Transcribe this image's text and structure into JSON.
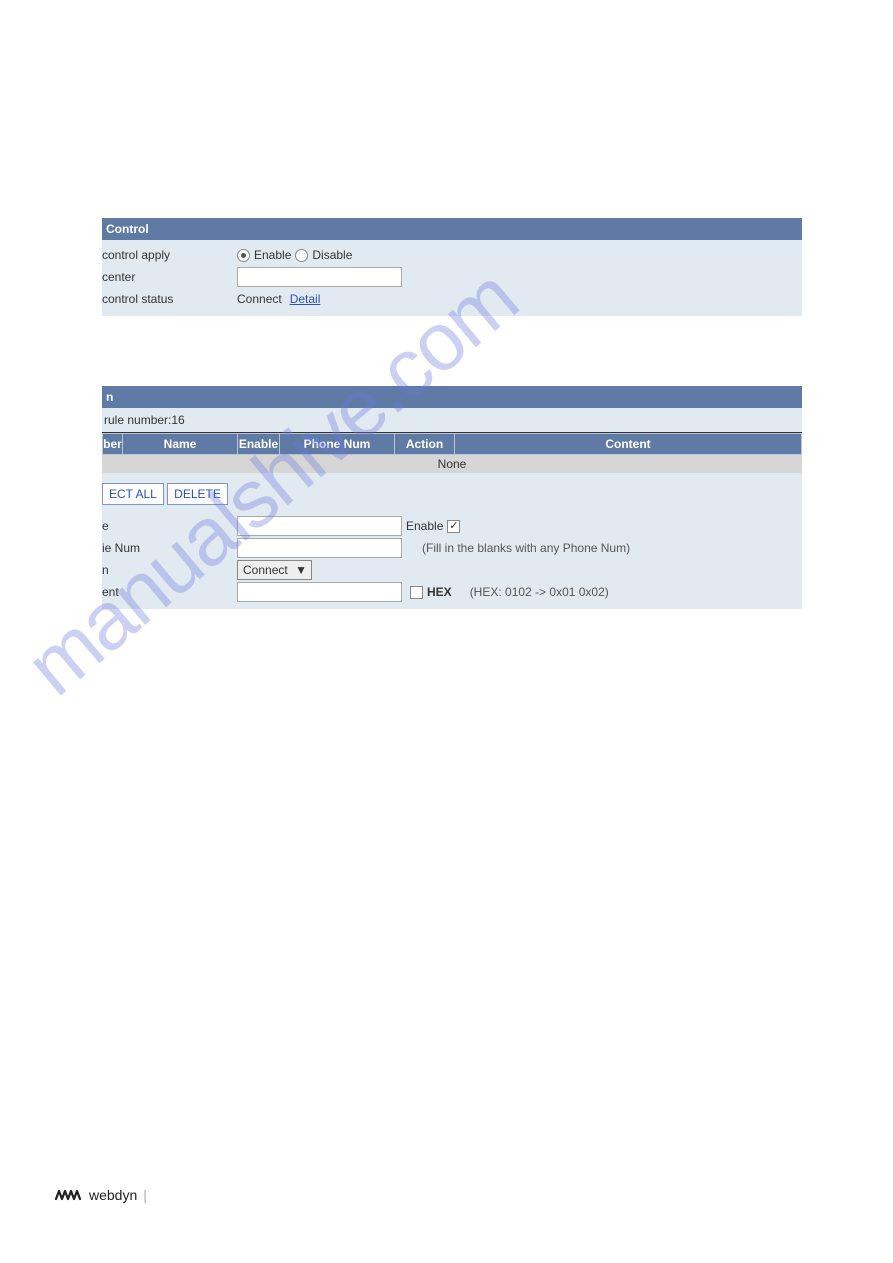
{
  "watermark": "manualshive.com",
  "panel1": {
    "title": "Control",
    "row_apply_label": "control apply",
    "radio_enable": "Enable",
    "radio_disable": "Disable",
    "row_center_label": "center",
    "row_status_label": "control status",
    "status_value": "Connect",
    "detail_link": "Detail"
  },
  "panel2": {
    "title_suffix": "n",
    "rule_text": "rule number:16",
    "cols": {
      "c1": "ber",
      "c2": "Name",
      "c3": "Enable",
      "c4": "Phone Num",
      "c5": "Action",
      "c6": "Content"
    },
    "none": "None",
    "btn_select": "ECT ALL",
    "btn_delete": "DELETE",
    "form": {
      "name_label": "e",
      "enable_label": "Enable",
      "phone_label": "ie Num",
      "phone_hint": "(Fill in the blanks with any Phone Num)",
      "action_label": "n",
      "action_value": "Connect",
      "content_label": "ent",
      "hex_label": "HEX",
      "hex_hint": "(HEX: 0102 -> 0x01 0x02)"
    }
  },
  "footer": {
    "wm": "░░░",
    "brand": "webdyn",
    "sub": "",
    "pipe": "|"
  }
}
